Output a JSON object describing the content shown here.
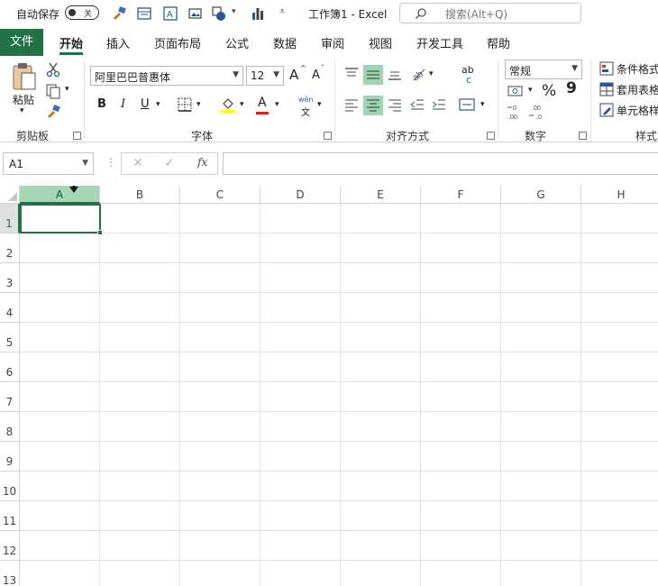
{
  "titlebar": {
    "autosave_label": "自动保存",
    "autosave_state": "关",
    "doc_title": "工作簿1 - Excel",
    "search_placeholder": "搜索(Alt+Q)"
  },
  "tabs": {
    "file": "文件",
    "items": [
      "开始",
      "插入",
      "页面布局",
      "公式",
      "数据",
      "审阅",
      "视图",
      "开发工具",
      "帮助"
    ],
    "active": "开始"
  },
  "ribbon": {
    "clipboard": {
      "paste": "粘贴",
      "label": "剪贴板"
    },
    "font": {
      "name": "阿里巴巴普惠体",
      "size": "12",
      "bold": "B",
      "italic": "I",
      "underline": "U",
      "font_color_glyph": "A",
      "wen_top": "wén",
      "wen_bottom": "文",
      "grow": "A",
      "shrink": "A",
      "label": "字体"
    },
    "alignment": {
      "label": "对齐方式",
      "wrap": "ab",
      "wrap2": "c"
    },
    "number": {
      "format": "常规",
      "percent": "%",
      "comma": "9",
      "label": "数字"
    },
    "styles": {
      "items": [
        "条件格式",
        "套用表格",
        "单元格样"
      ],
      "label": "样式"
    },
    "accent_color": "#217346"
  },
  "formula_bar": {
    "name_box": "A1",
    "fx": "fx",
    "value": ""
  },
  "grid": {
    "columns": [
      "A",
      "B",
      "C",
      "D",
      "E",
      "F",
      "G",
      "H"
    ],
    "rows": [
      "1",
      "2",
      "3",
      "4",
      "5",
      "6",
      "7",
      "8",
      "9",
      "10",
      "11",
      "12",
      "13"
    ],
    "active_cell": "A1"
  }
}
